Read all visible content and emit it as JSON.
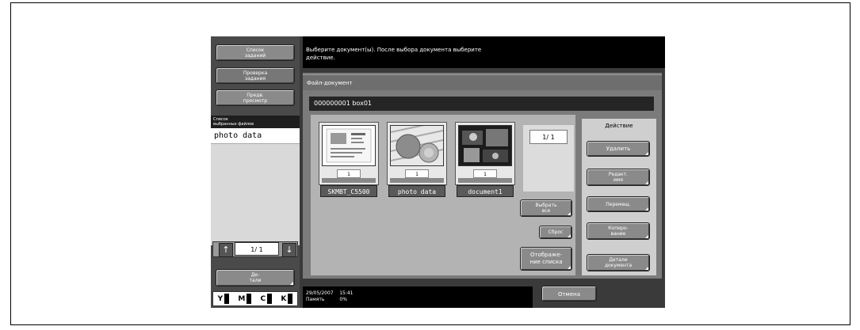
{
  "left_nav": {
    "job_list": "Список\nзаданий",
    "job_check": "Проверка\nзадания",
    "preview": "Предв.\nпросмотр"
  },
  "selected_files": {
    "header": "Список\nвыбранных файлов",
    "items": [
      "photo data"
    ],
    "page": "1/ 1",
    "detail_button": "Де-\nтали"
  },
  "toner": [
    "Y",
    "M",
    "C",
    "K"
  ],
  "message": "Выберите документ(ы). После выбора документа выберите\nдействие.",
  "panel": {
    "title": "Файл-документ",
    "box": "000000001   box01"
  },
  "documents": [
    {
      "name": "SKMBT_C5500",
      "count": "1"
    },
    {
      "name": "photo data",
      "count": "1"
    },
    {
      "name": "document1",
      "count": "1"
    }
  ],
  "counter": "1/  1",
  "middle_buttons": {
    "select_all": "Выбрать\nвсе",
    "reset": "Сброс",
    "list_view": "Отображе-\nние списка"
  },
  "actions": {
    "title": "Действие",
    "delete": "Удалить",
    "rename": "Редакт.\nимя",
    "move": "Перемещ.",
    "copy": "Копиро-\nвание",
    "doc_details": "Детали\nдокумента"
  },
  "status": {
    "datetime": "29/05/2007    15:41",
    "memory": "Память          0%"
  },
  "cancel": "Отмена",
  "colors": {
    "screen_bg": "#3a3a3a",
    "button_gray": "#8a8a8a",
    "panel_gray": "#7b7b7b"
  }
}
